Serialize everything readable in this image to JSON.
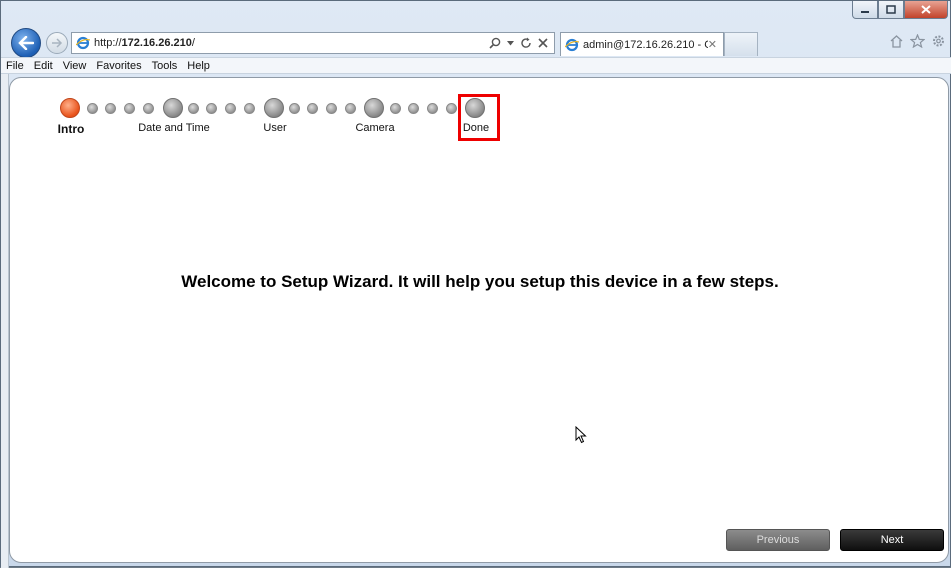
{
  "browser": {
    "address": {
      "prefix": "http://",
      "host": "172.16.26.210",
      "suffix": "/"
    },
    "tab_title": "admin@172.16.26.210 - Co...",
    "menu": [
      "File",
      "Edit",
      "View",
      "Favorites",
      "Tools",
      "Help"
    ]
  },
  "wizard": {
    "steps": [
      {
        "label": "Intro",
        "current": true
      },
      {
        "label": "Date and Time",
        "current": false
      },
      {
        "label": "User",
        "current": false
      },
      {
        "label": "Camera",
        "current": false
      },
      {
        "label": "Done",
        "current": false
      }
    ],
    "welcome_text": "Welcome to Setup Wizard. It will help you setup this device in a few steps.",
    "previous_label": "Previous",
    "next_label": "Next"
  },
  "colors": {
    "active_step": "#e8521a",
    "highlight_box": "#e00000",
    "next_button": "#1a1a1a",
    "previous_button": "#707070"
  }
}
